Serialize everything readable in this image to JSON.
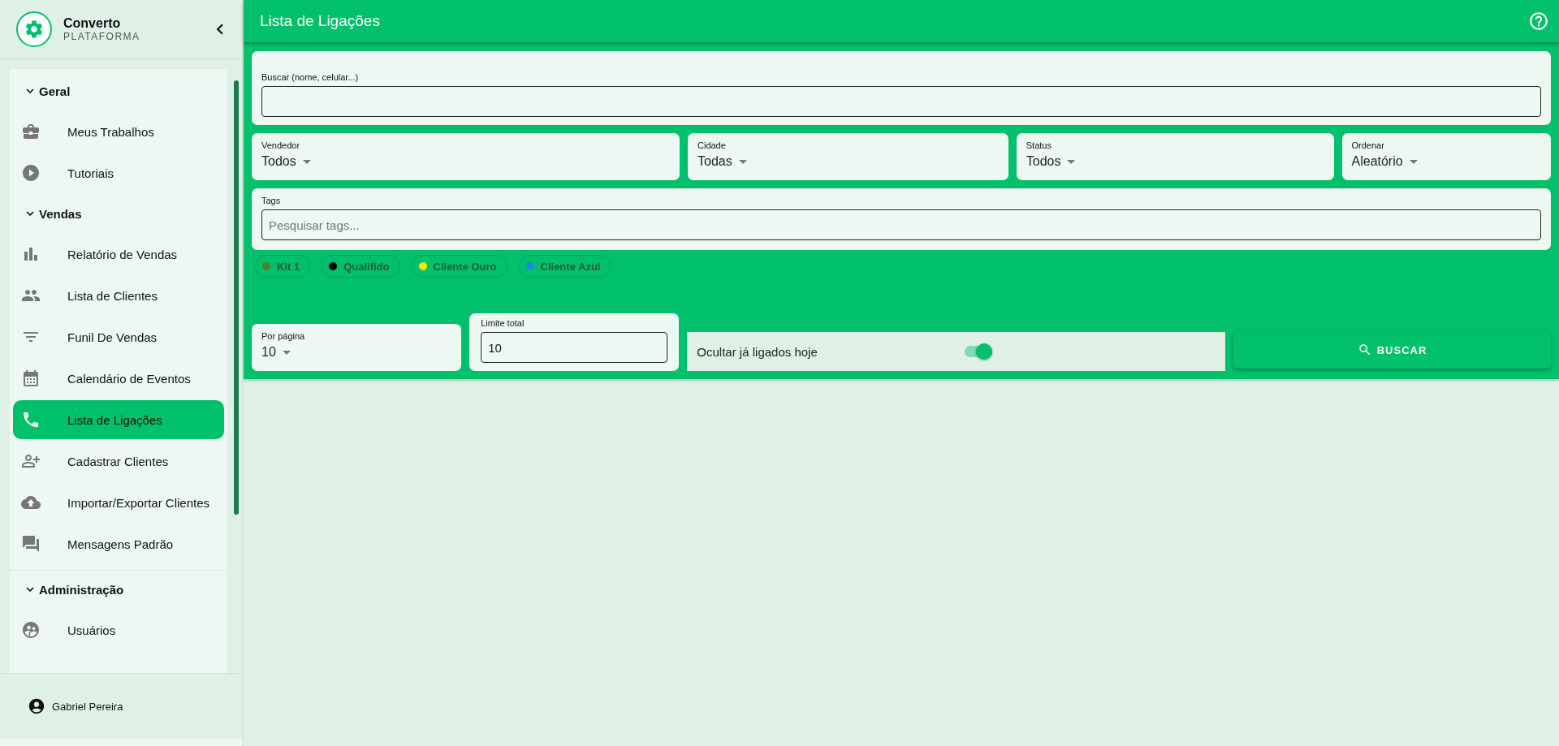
{
  "brand": {
    "name": "Converto",
    "subtitle": "PLATAFORMA"
  },
  "sidebar": {
    "sections": [
      {
        "title": "Geral",
        "expanded": true,
        "items": [
          {
            "label": "Meus Trabalhos",
            "selected": false
          },
          {
            "label": "Tutoriais",
            "selected": false
          }
        ]
      },
      {
        "title": "Vendas",
        "expanded": true,
        "items": [
          {
            "label": "Relatório de Vendas",
            "selected": false
          },
          {
            "label": "Lista de Clientes",
            "selected": false
          },
          {
            "label": "Funil De Vendas",
            "selected": false
          },
          {
            "label": "Calendário de Eventos",
            "selected": false
          },
          {
            "label": "Lista de Ligações",
            "selected": true
          },
          {
            "label": "Cadastrar Clientes",
            "selected": false
          },
          {
            "label": "Importar/Exportar Clientes",
            "selected": false
          },
          {
            "label": "Mensagens Padrão",
            "selected": false
          }
        ]
      },
      {
        "title": "Administração",
        "expanded": true,
        "items": [
          {
            "label": "Usuários",
            "selected": false
          }
        ]
      }
    ],
    "user": "Gabriel Pereira"
  },
  "page_title": "Lista de Ligações",
  "search": {
    "label": "Buscar (nome, celular...)"
  },
  "filters": [
    {
      "label": "Vendedor",
      "value": "Todos"
    },
    {
      "label": "Cidade",
      "value": "Todas"
    },
    {
      "label": "Status",
      "value": "Todos"
    },
    {
      "label": "Ordenar",
      "value": "Aleatório"
    }
  ],
  "tags": {
    "label": "Tags",
    "placeholder": "Pesquisar tags..."
  },
  "tag_chips": [
    {
      "label": "Kit 1",
      "color": "#4f7f2c"
    },
    {
      "label": "Qualifido",
      "color": "#000000"
    },
    {
      "label": "Cliente Ouro",
      "color": "#ffe600"
    },
    {
      "label": "Cliente Azul",
      "color": "#1e88e5"
    }
  ],
  "per_page": {
    "label": "Por página",
    "value": "10"
  },
  "total_limit": {
    "label": "Limite total",
    "value": "10"
  },
  "hide_called": {
    "label": "Ocultar já ligados hoje",
    "on": true
  },
  "search_button": "BUSCAR"
}
